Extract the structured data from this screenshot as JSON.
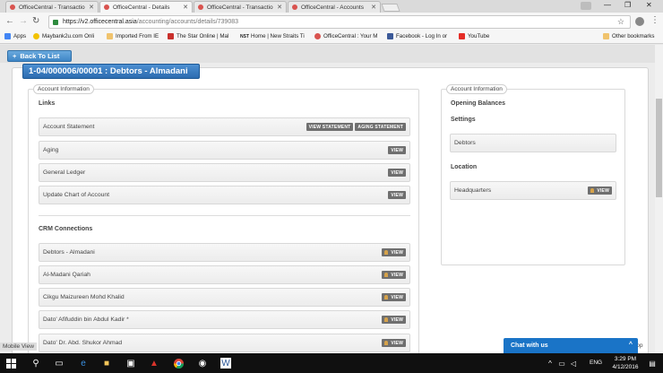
{
  "browser": {
    "tabs": [
      {
        "label": "OfficeCentral - Transactio",
        "active": false
      },
      {
        "label": "OfficeCentral - Details",
        "active": true
      },
      {
        "label": "OfficeCentral - Transactio",
        "active": false
      },
      {
        "label": "OfficeCentral - Accounts",
        "active": false
      }
    ],
    "url_host": "https://v2.officecentral.asia",
    "url_path": "/accounting/accounts/details/739083",
    "bookmarks": [
      {
        "label": "Apps",
        "color": "#4285f4"
      },
      {
        "label": "Maybank2u.com Onli",
        "color": "#f2c200"
      },
      {
        "label": "Imported From IE",
        "color": "#f0c36d"
      },
      {
        "label": "The Star Online | Mal",
        "color": "#c9302c"
      },
      {
        "label": "Home | New Straits Ti",
        "color": "#333333"
      },
      {
        "label": "OfficeCentral : Your M",
        "color": "#d9534f"
      },
      {
        "label": "Facebook - Log In or",
        "color": "#3b5998"
      },
      {
        "label": "YouTube",
        "color": "#e52d27"
      }
    ],
    "other_bookmarks": "Other bookmarks",
    "bookmark_abbrev": "NST"
  },
  "page": {
    "back_label": "Back To List",
    "account_title": "1-04/000006/00001 : Debtors - Almadani",
    "left_legend": "Account Information",
    "links_heading": "Links",
    "links": [
      {
        "label": "Account Statement",
        "buttons": [
          "VIEW STATEMENT",
          "AGING STATEMENT"
        ]
      },
      {
        "label": "Aging",
        "buttons": [
          "VIEW"
        ]
      },
      {
        "label": "General Ledger",
        "buttons": [
          "VIEW"
        ]
      },
      {
        "label": "Update Chart of Account",
        "buttons": [
          "VIEW"
        ]
      }
    ],
    "crm_heading": "CRM Connections",
    "crm": [
      {
        "label": "Debtors - Almadani",
        "button": "VIEW"
      },
      {
        "label": "Al-Madani Qariah",
        "button": "VIEW"
      },
      {
        "label": "Cikgu Maizureen Mohd Khalid",
        "button": "VIEW"
      },
      {
        "label": "Dato' Afifuddin bin Abdul Kadir *",
        "button": "VIEW"
      },
      {
        "label": "Dato' Dr. Abd. Shukor Ahmad",
        "button": "VIEW"
      }
    ],
    "right_legend": "Account Information",
    "opening_balances": "Opening Balances",
    "settings_heading": "Settings",
    "settings_item": "Debtors",
    "location_heading": "Location",
    "location_item": "Headquarters",
    "location_button": "VIEW",
    "mobile_view": "Mobile View",
    "to_top": "Top",
    "chat_label": "Chat with us"
  },
  "taskbar": {
    "language": "ENG",
    "time": "3:29 PM",
    "date": "4/12/2016"
  }
}
